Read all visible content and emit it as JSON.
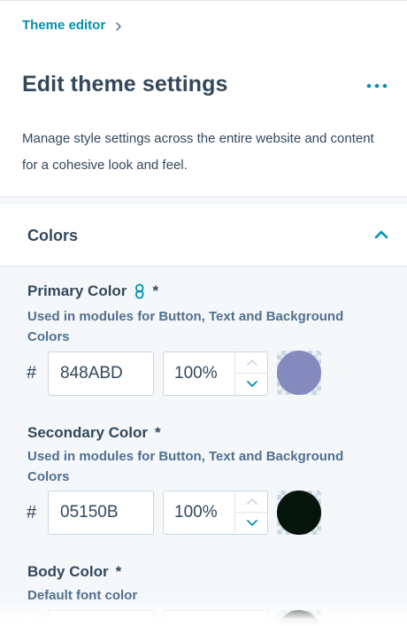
{
  "breadcrumb": {
    "label": "Theme editor"
  },
  "page": {
    "title": "Edit theme settings",
    "description": "Manage style settings across the entire website and content for a cohesive look and feel."
  },
  "section": {
    "title": "Colors",
    "expanded": true
  },
  "fields": [
    {
      "label": "Primary Color",
      "required": "*",
      "linked": true,
      "help": "Used in modules for Button, Text and Background Colors",
      "hash": "#",
      "hex": "848ABD",
      "opacity": "100%",
      "color": "#848ABD"
    },
    {
      "label": "Secondary Color",
      "required": "*",
      "linked": false,
      "help": "Used in modules for Button, Text and Background Colors",
      "hash": "#",
      "hex": "05150B",
      "opacity": "100%",
      "color": "#05150B"
    },
    {
      "label": "Body Color",
      "required": "*",
      "linked": false,
      "help": "Default font color",
      "hash": "#",
      "hex": "",
      "opacity": "",
      "color": "#0b1a10"
    }
  ],
  "colors": {
    "accent": "#0091ae",
    "text": "#33475b",
    "help_text": "#516f90",
    "border": "#cbd6e2"
  }
}
